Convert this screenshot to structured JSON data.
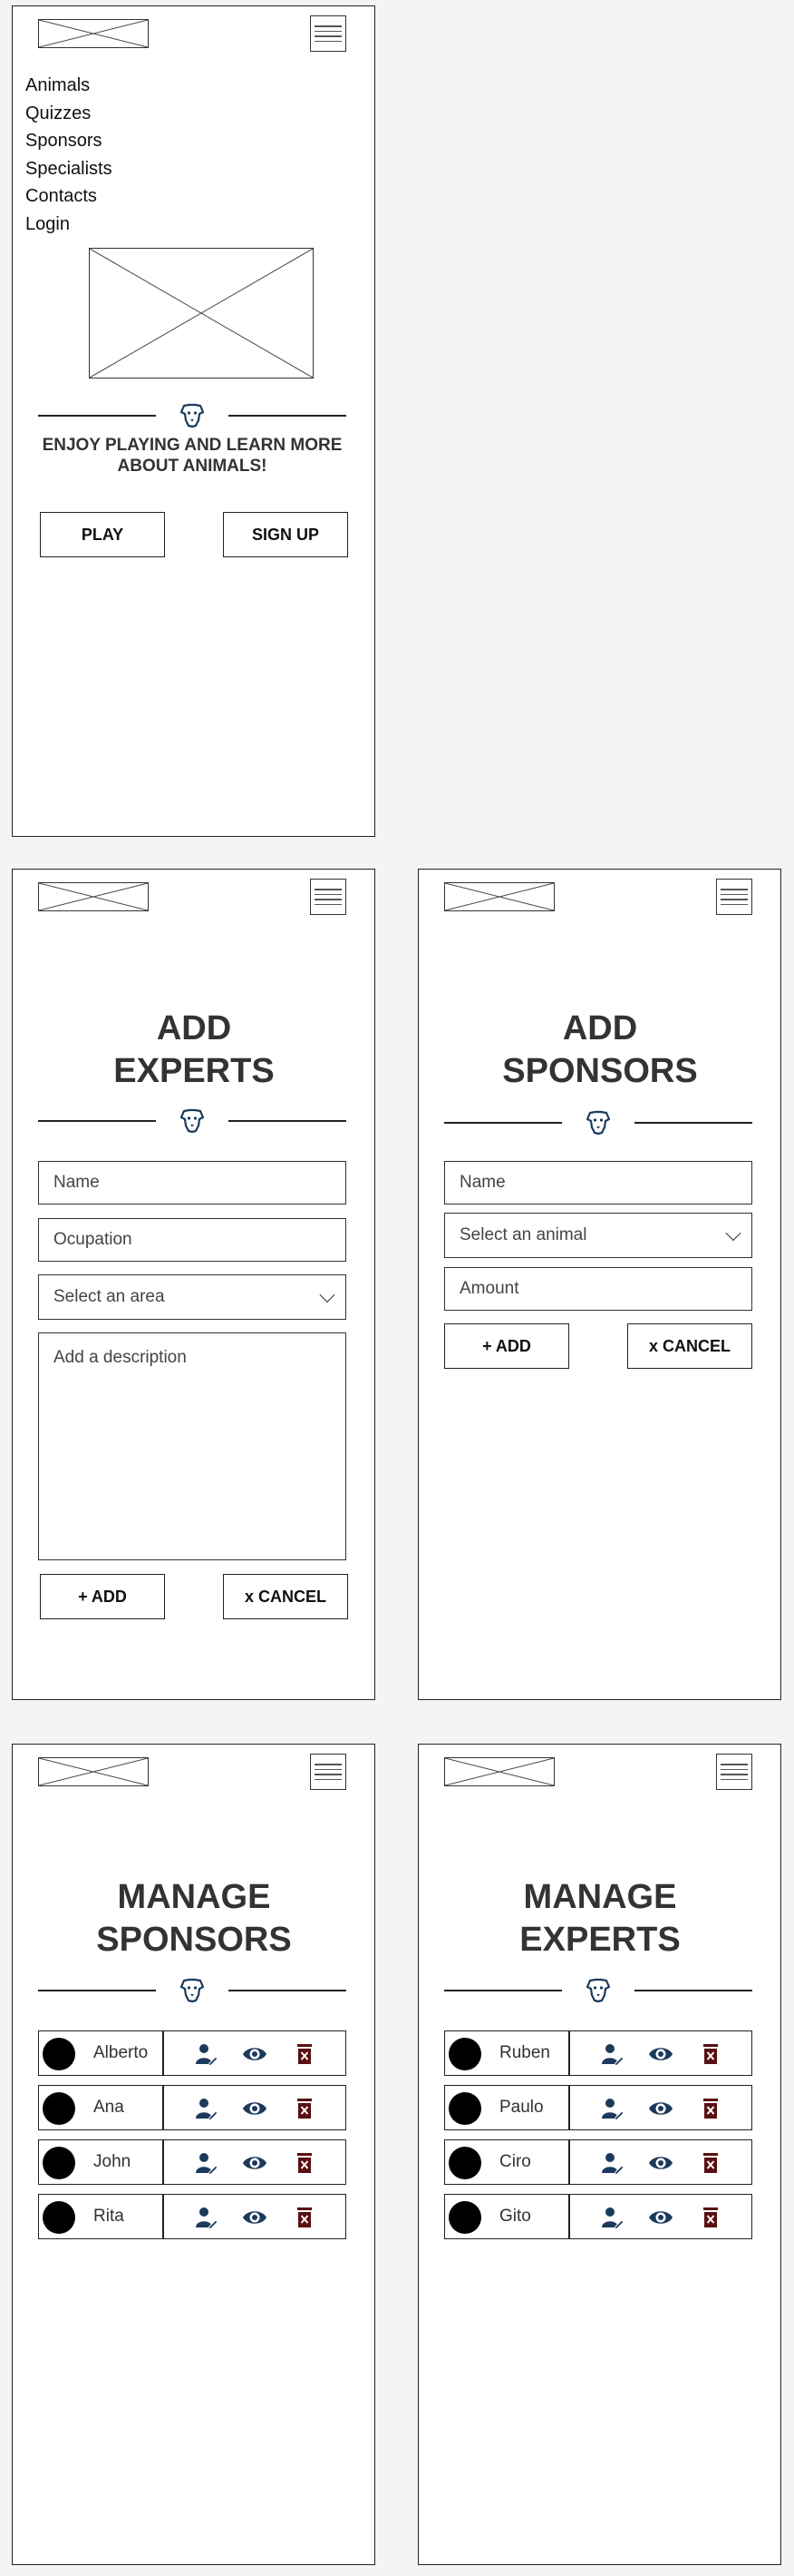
{
  "colors": {
    "accent": "#1b3a5c",
    "danger": "#5a1010",
    "border": "#222222"
  },
  "home": {
    "nav": [
      "Animals",
      "Quizzes",
      "Sponsors",
      "Specialists",
      "Contacts",
      "Login"
    ],
    "tagline": "ENJOY PLAYING AND LEARN MORE ABOUT ANIMALS!",
    "play_label": "PLAY",
    "signup_label": "SIGN UP"
  },
  "add_experts": {
    "title_line1": "ADD",
    "title_line2": "EXPERTS",
    "name_placeholder": "Name",
    "occupation_placeholder": "Ocupation",
    "area_placeholder": "Select an area",
    "description_placeholder": "Add a description",
    "add_label": "+ ADD",
    "cancel_label": "x CANCEL"
  },
  "add_sponsors": {
    "title_line1": "ADD",
    "title_line2": "SPONSORS",
    "name_placeholder": "Name",
    "animal_placeholder": "Select an animal",
    "amount_placeholder": "Amount",
    "add_label": "+ ADD",
    "cancel_label": "x CANCEL"
  },
  "manage_sponsors": {
    "title_line1": "MANAGE",
    "title_line2": "SPONSORS",
    "rows": [
      {
        "name": "Alberto"
      },
      {
        "name": "Ana"
      },
      {
        "name": "John"
      },
      {
        "name": "Rita"
      }
    ]
  },
  "manage_experts": {
    "title_line1": "MANAGE",
    "title_line2": "EXPERTS",
    "rows": [
      {
        "name": "Ruben"
      },
      {
        "name": "Paulo"
      },
      {
        "name": "Ciro"
      },
      {
        "name": "Gito"
      }
    ]
  }
}
